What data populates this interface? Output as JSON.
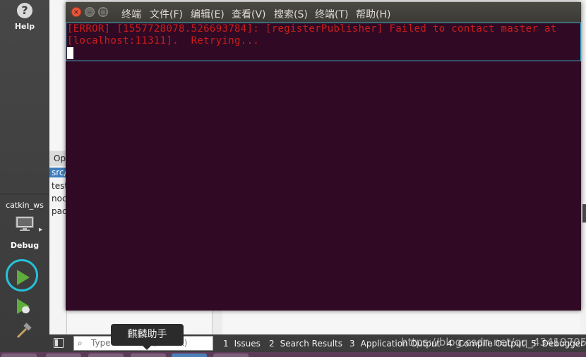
{
  "qtcreator": {
    "modes": {
      "help_label": "Help",
      "project_label": "catkin_ws",
      "debug_label": "Debug"
    },
    "open_documents": {
      "header": "Op",
      "items": [
        "src/",
        "test",
        "noc",
        "pac"
      ]
    },
    "locator": {
      "placeholder": "Type to locate (Ctrl+K)"
    },
    "output_tabs": [
      {
        "num": "1",
        "label": "Issues"
      },
      {
        "num": "2",
        "label": "Search Results"
      },
      {
        "num": "3",
        "label": "Application Output"
      },
      {
        "num": "4",
        "label": "Compile Output"
      },
      {
        "num": "5",
        "label": "Debugger C"
      }
    ],
    "watermark": "https://blog.csdn.net/qq_43419705"
  },
  "tooltip": {
    "text": "麒麟助手"
  },
  "terminal": {
    "title": "终端",
    "menu": [
      "文件(F)",
      "编辑(E)",
      "查看(V)",
      "搜索(S)",
      "终端(T)",
      "帮助(H)"
    ],
    "output_lines": [
      "[ERROR] [1557728078.526693784]: [registerPublisher] Failed to contact master at",
      "[localhost:11311].  Retrying..."
    ]
  },
  "colors": {
    "terminal_bg": "#300a24",
    "error_text": "#cc1d1d",
    "run_ring": "#25c1d9",
    "run_green": "#5fae3c"
  }
}
